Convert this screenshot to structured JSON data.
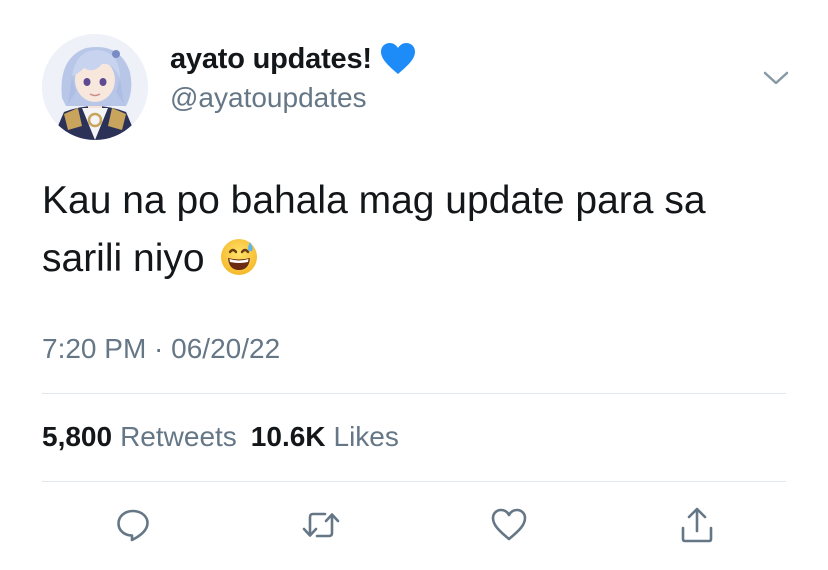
{
  "user": {
    "display_name": "ayato updates!",
    "handle": "@ayatoupdates",
    "avatar_icon": "avatar-ayato-icon",
    "badge_icon": "blue-heart-icon",
    "badge_color": "#1d8cf8"
  },
  "tweet": {
    "text_line1": "Kau na po bahala mag update para sa",
    "text_line2": "sarili niyo",
    "emoji_icon": "grinning-sweat-emoji",
    "timestamp": "7:20 PM · 06/20/22"
  },
  "stats": {
    "retweets_count": "5,800",
    "retweets_label": "Retweets",
    "likes_count": "10.6K",
    "likes_label": "Likes"
  },
  "actions": {
    "reply_icon": "reply-icon",
    "retweet_icon": "retweet-icon",
    "like_icon": "like-icon",
    "share_icon": "share-icon"
  },
  "colors": {
    "text_primary": "#14171a",
    "text_secondary": "#657786",
    "divider": "#e1e8ed"
  }
}
